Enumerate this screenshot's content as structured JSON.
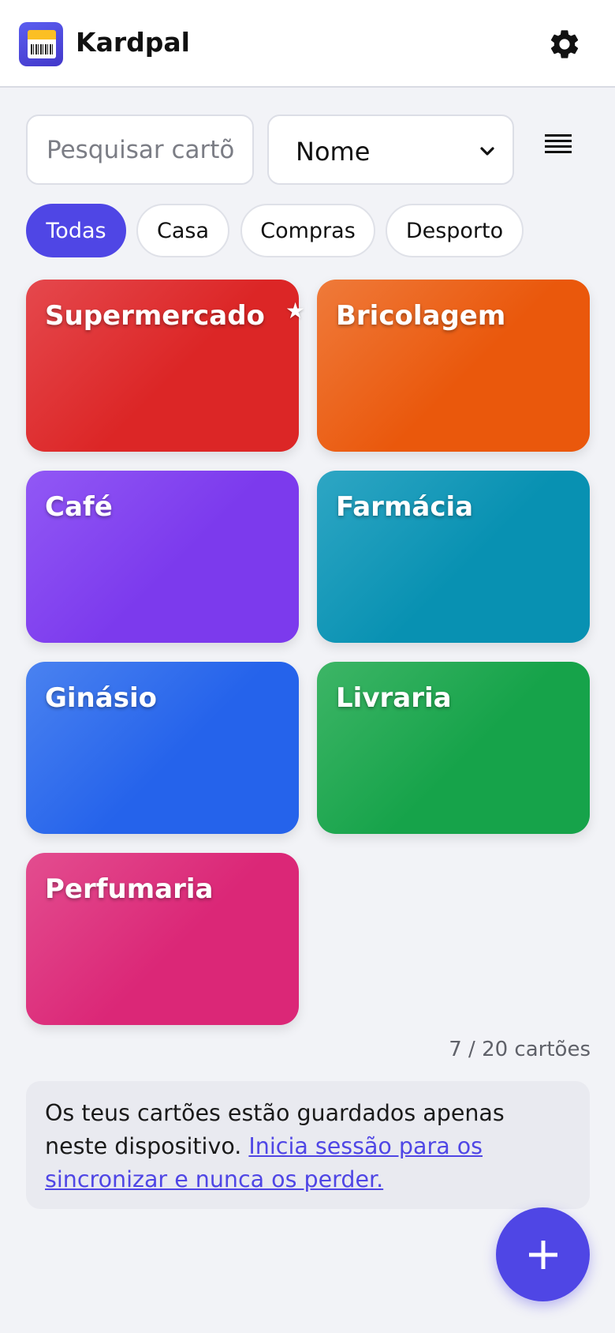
{
  "app": {
    "title": "Kardpal",
    "logo_icon": "barcode-card-icon",
    "settings_icon": "gear-icon"
  },
  "search": {
    "placeholder": "Pesquisar cartões",
    "value": ""
  },
  "sort": {
    "selected": "Nome"
  },
  "view_toggle_icon": "list-view-icon",
  "filters": [
    {
      "label": "Todas",
      "active": true
    },
    {
      "label": "Casa",
      "active": false
    },
    {
      "label": "Compras",
      "active": false
    },
    {
      "label": "Desporto",
      "active": false
    }
  ],
  "cards": [
    {
      "name": "Supermercado",
      "favorite": true,
      "color": "#dc2626"
    },
    {
      "name": "Bricolagem",
      "favorite": false,
      "color": "#ea580c"
    },
    {
      "name": "Café",
      "favorite": false,
      "color": "#7c3aed"
    },
    {
      "name": "Farmácia",
      "favorite": false,
      "color": "#0891b2"
    },
    {
      "name": "Ginásio",
      "favorite": false,
      "color": "#2563eb"
    },
    {
      "name": "Livraria",
      "favorite": false,
      "color": "#16a34a"
    },
    {
      "name": "Perfumaria",
      "favorite": false,
      "color": "#db2777"
    }
  ],
  "favorite_mark": "★",
  "count_label": "7 / 20 cartões",
  "notice": {
    "text": "Os teus cartões estão guardados apenas neste dispositivo.",
    "link": "Inicia sessão para os sincronizar e nunca os perder."
  },
  "fab_icon": "plus-icon",
  "colors": {
    "accent": "#4f46e5",
    "background": "#f2f3f7"
  }
}
